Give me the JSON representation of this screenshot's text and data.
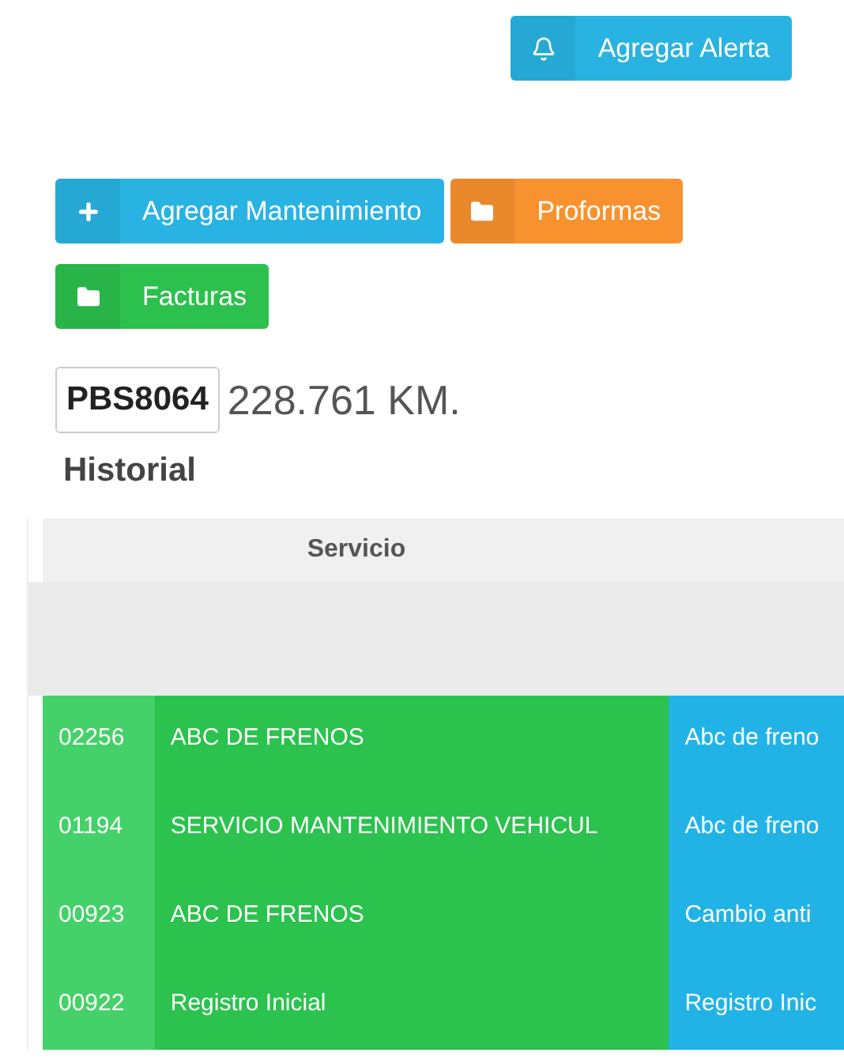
{
  "alert_button": {
    "label": "Agregar Alerta",
    "kind": "alert"
  },
  "action_buttons": [
    {
      "label": "Agregar Mantenimiento",
      "kind": "add",
      "color": "#29b3e2"
    },
    {
      "label": "Proformas",
      "kind": "files",
      "color": "#f8922f"
    },
    {
      "label": "Facturas",
      "kind": "files",
      "color": "#2cc04d"
    }
  ],
  "plate": "PBS8064",
  "mileage": "228.761 KM.",
  "history": {
    "title": "Historial",
    "columns": [
      "Servicio"
    ],
    "rows": [
      {
        "code": "02256",
        "service": "ABC DE FRENOS",
        "column_3": "Abc de freno"
      },
      {
        "code": "01194",
        "service": "SERVICIO MANTENIMIENTO VEHICUL",
        "column_3": "Abc de freno"
      },
      {
        "code": "00923",
        "service": "ABC DE FRENOS",
        "column_3": "Cambio anti"
      },
      {
        "code": "00922",
        "service": "Registro Inicial",
        "column_3": "Registro Inic"
      }
    ]
  }
}
